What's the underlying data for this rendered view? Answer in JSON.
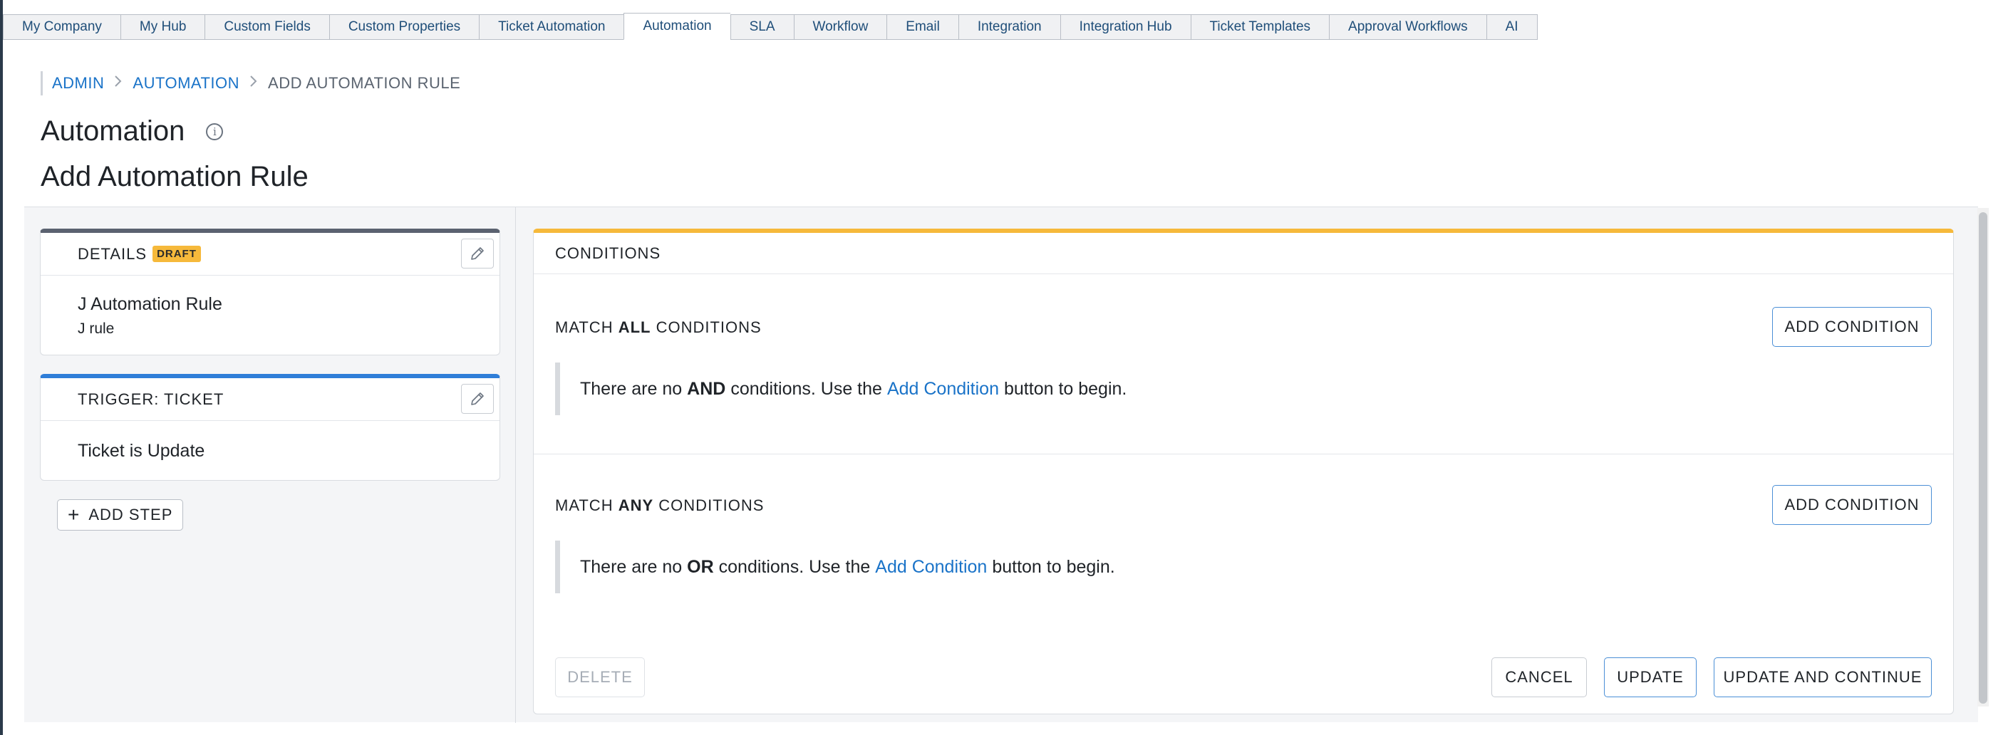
{
  "tabs": [
    {
      "label": "My Company",
      "active": false
    },
    {
      "label": "My Hub",
      "active": false
    },
    {
      "label": "Custom Fields",
      "active": false
    },
    {
      "label": "Custom Properties",
      "active": false
    },
    {
      "label": "Ticket Automation",
      "active": false
    },
    {
      "label": "Automation",
      "active": true
    },
    {
      "label": "SLA",
      "active": false
    },
    {
      "label": "Workflow",
      "active": false
    },
    {
      "label": "Email",
      "active": false
    },
    {
      "label": "Integration",
      "active": false
    },
    {
      "label": "Integration Hub",
      "active": false
    },
    {
      "label": "Ticket Templates",
      "active": false
    },
    {
      "label": "Approval Workflows",
      "active": false
    },
    {
      "label": "AI",
      "active": false
    }
  ],
  "breadcrumb": {
    "admin": "ADMIN",
    "automation": "AUTOMATION",
    "current": "ADD AUTOMATION RULE",
    "separator": ">"
  },
  "header": {
    "title": "Automation",
    "info_glyph": "i",
    "subtitle": "Add Automation Rule"
  },
  "details": {
    "heading": "DETAILS",
    "badge": "DRAFT",
    "rule_name": "J Automation Rule",
    "rule_description": "J rule"
  },
  "trigger": {
    "heading": "TRIGGER: TICKET",
    "summary": "Ticket is Update"
  },
  "add_step": {
    "plus": "+",
    "label": "ADD STEP"
  },
  "conditions": {
    "heading": "CONDITIONS",
    "all": {
      "prefix": "MATCH",
      "emphasis": "ALL",
      "suffix": "CONDITIONS",
      "add_label": "ADD CONDITION",
      "empty_pre": "There are no",
      "empty_keyword": "AND",
      "empty_mid": "conditions. Use the",
      "empty_link": "Add Condition",
      "empty_post": "button to begin."
    },
    "any": {
      "prefix": "MATCH",
      "emphasis": "ANY",
      "suffix": "CONDITIONS",
      "add_label": "ADD CONDITION",
      "empty_pre": "There are no",
      "empty_keyword": "OR",
      "empty_mid": "conditions. Use the",
      "empty_link": "Add Condition",
      "empty_post": "button to begin."
    }
  },
  "footer": {
    "delete_label": "DELETE",
    "cancel_label": "CANCEL",
    "update_label": "UPDATE",
    "update_continue_label": "UPDATE AND CONTINUE"
  },
  "colors": {
    "accent_blue": "#2f7ed8",
    "draft_yellow": "#f6b93b",
    "details_gray": "#5b6270",
    "link_blue": "#1a73c8"
  },
  "icons": {
    "edit": "pencil-icon",
    "info": "info-icon",
    "crumb_sep": "chevron-right-icon"
  }
}
